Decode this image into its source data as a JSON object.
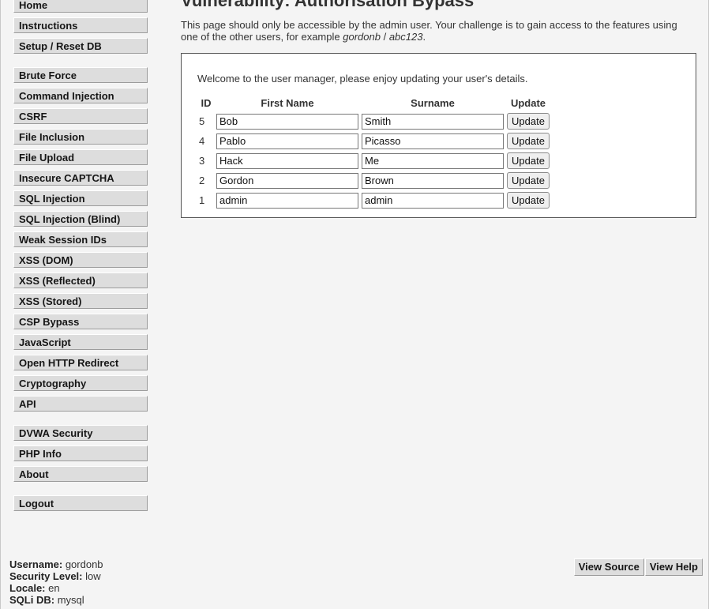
{
  "menu": {
    "group1": [
      "Home",
      "Instructions",
      "Setup / Reset DB"
    ],
    "group2": [
      "Brute Force",
      "Command Injection",
      "CSRF",
      "File Inclusion",
      "File Upload",
      "Insecure CAPTCHA",
      "SQL Injection",
      "SQL Injection (Blind)",
      "Weak Session IDs",
      "XSS (DOM)",
      "XSS (Reflected)",
      "XSS (Stored)",
      "CSP Bypass",
      "JavaScript",
      "Open HTTP Redirect",
      "Cryptography",
      "API"
    ],
    "group3": [
      "DVWA Security",
      "PHP Info",
      "About"
    ],
    "group4": [
      "Logout"
    ]
  },
  "page": {
    "title": "Vulnerability: Authorisation Bypass",
    "intro_text": "This page should only be accessible by the admin user. Your challenge is to gain access to the features using one of the other users, for example",
    "example_user": "gordonb",
    "separator": " / ",
    "example_pass": "abc123",
    "period": "."
  },
  "user_manager": {
    "welcome": "Welcome to the user manager, please enjoy updating your user's details.",
    "headers": {
      "id": "ID",
      "first": "First Name",
      "surname": "Surname",
      "update": "Update"
    },
    "update_label": "Update",
    "rows": [
      {
        "id": "5",
        "first": "Bob",
        "surname": "Smith"
      },
      {
        "id": "4",
        "first": "Pablo",
        "surname": "Picasso"
      },
      {
        "id": "3",
        "first": "Hack",
        "surname": "Me"
      },
      {
        "id": "2",
        "first": "Gordon",
        "surname": "Brown"
      },
      {
        "id": "1",
        "first": "admin",
        "surname": "admin"
      }
    ]
  },
  "footer": {
    "username_label": "Username:",
    "username": "gordonb",
    "security_label": "Security Level:",
    "security": "low",
    "locale_label": "Locale:",
    "locale": "en",
    "sqli_label": "SQLi DB:",
    "sqli": "mysql",
    "view_source": "View Source",
    "view_help": "View Help"
  }
}
